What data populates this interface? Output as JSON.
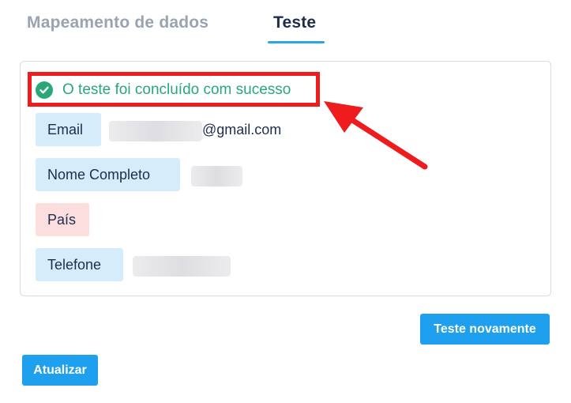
{
  "tabs": [
    {
      "label": "Mapeamento de dados"
    },
    {
      "label": "Teste"
    }
  ],
  "result": {
    "success_message": "O teste foi concluído com sucesso"
  },
  "fields": [
    {
      "label": "Email",
      "value": "@gmail.com",
      "status": "ok"
    },
    {
      "label": "Nome Completo",
      "value": "",
      "status": "ok"
    },
    {
      "label": "País",
      "value": "",
      "status": "missing"
    },
    {
      "label": "Telefone",
      "value": "",
      "status": "ok"
    }
  ],
  "buttons": {
    "retest": "Teste novamente",
    "update": "Atualizar"
  },
  "colors": {
    "accent": "#1fa0ee",
    "success": "#28a879",
    "annotation": "#ee1c1c"
  }
}
